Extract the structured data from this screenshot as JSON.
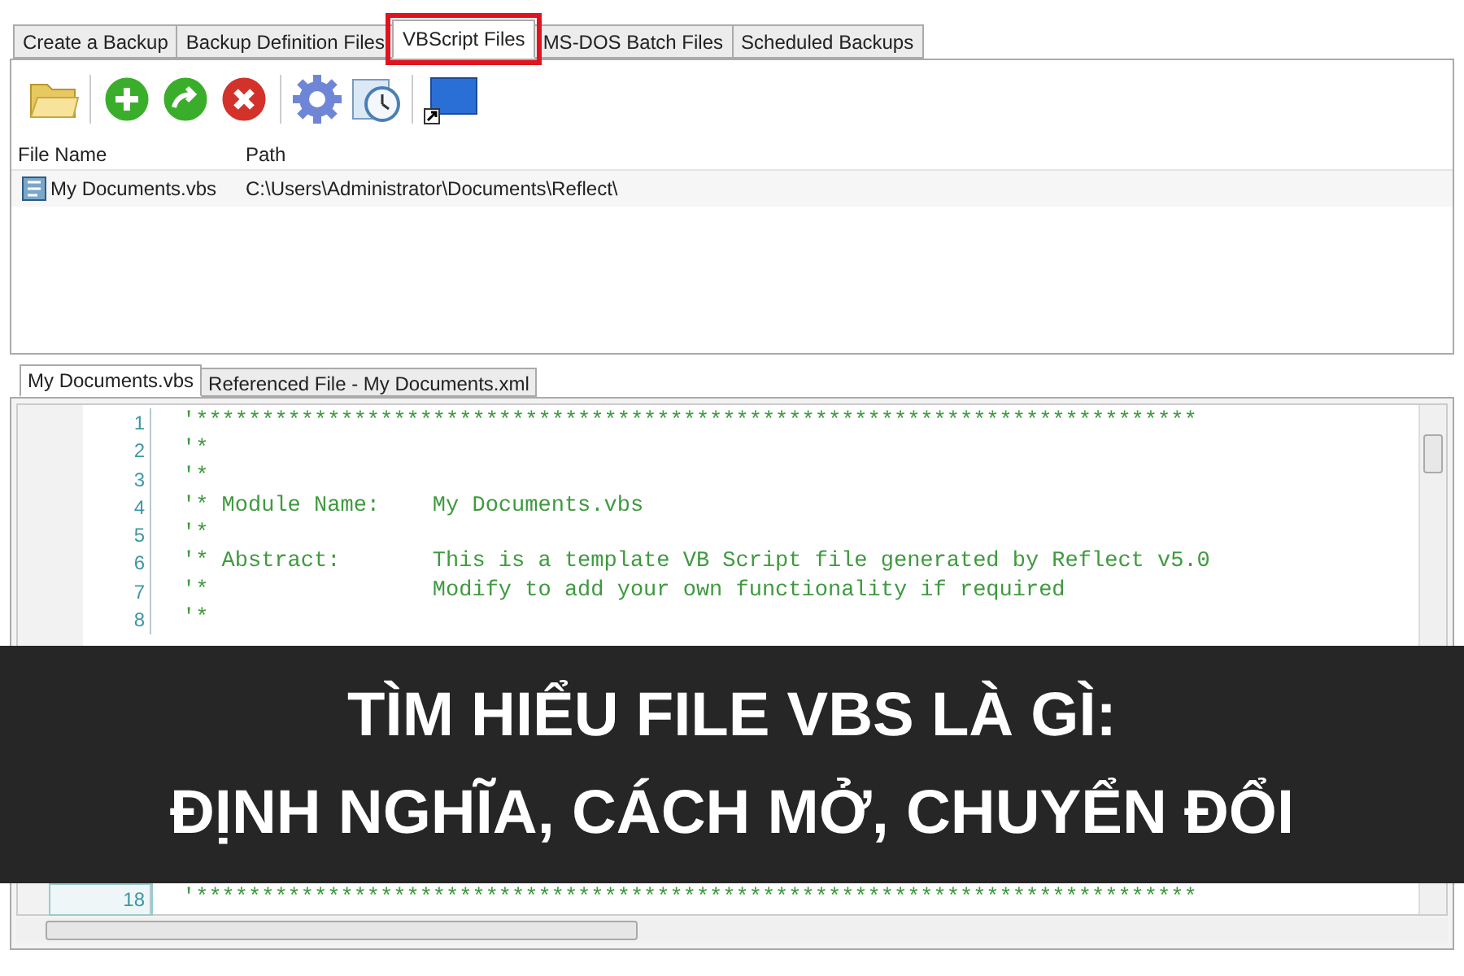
{
  "tabs": [
    {
      "label": "Create a Backup",
      "selected": false,
      "highlighted": false
    },
    {
      "label": "Backup Definition Files",
      "selected": false,
      "highlighted": false
    },
    {
      "label": "VBScript Files",
      "selected": true,
      "highlighted": true
    },
    {
      "label": "MS-DOS Batch Files",
      "selected": false,
      "highlighted": false
    },
    {
      "label": "Scheduled Backups",
      "selected": false,
      "highlighted": false
    }
  ],
  "file_list": {
    "columns": [
      "File Name",
      "Path"
    ],
    "rows": [
      {
        "file_name": "My Documents.vbs",
        "path": "C:\\Users\\Administrator\\Documents\\Reflect\\"
      }
    ]
  },
  "editor_tabs": [
    {
      "label": "My Documents.vbs",
      "selected": true
    },
    {
      "label": "Referenced File - My Documents.xml",
      "selected": false
    }
  ],
  "code_lines": [
    {
      "number": "1",
      "text": "'****************************************************************************",
      "current": false
    },
    {
      "number": "2",
      "text": "'*",
      "current": false
    },
    {
      "number": "3",
      "text": "'*",
      "current": false
    },
    {
      "number": "4",
      "text": "'* Module Name:    My Documents.vbs",
      "current": false
    },
    {
      "number": "5",
      "text": "'*",
      "current": false
    },
    {
      "number": "6",
      "text": "'* Abstract:       This is a template VB Script file generated by Reflect v5.0",
      "current": false
    },
    {
      "number": "7",
      "text": "'*                 Modify to add your own functionality if required",
      "current": false
    },
    {
      "number": "8",
      "text": "'*",
      "current": false
    }
  ],
  "code_lines_after_banner": [
    {
      "number": "18",
      "text": "'****************************************************************************",
      "current": true
    }
  ],
  "banner": {
    "lines": [
      "TÌM HIỂU FILE VBS LÀ GÌ:",
      "ĐỊNH NGHĨA, CÁCH MỞ, CHUYỂN ĐỔI"
    ]
  }
}
